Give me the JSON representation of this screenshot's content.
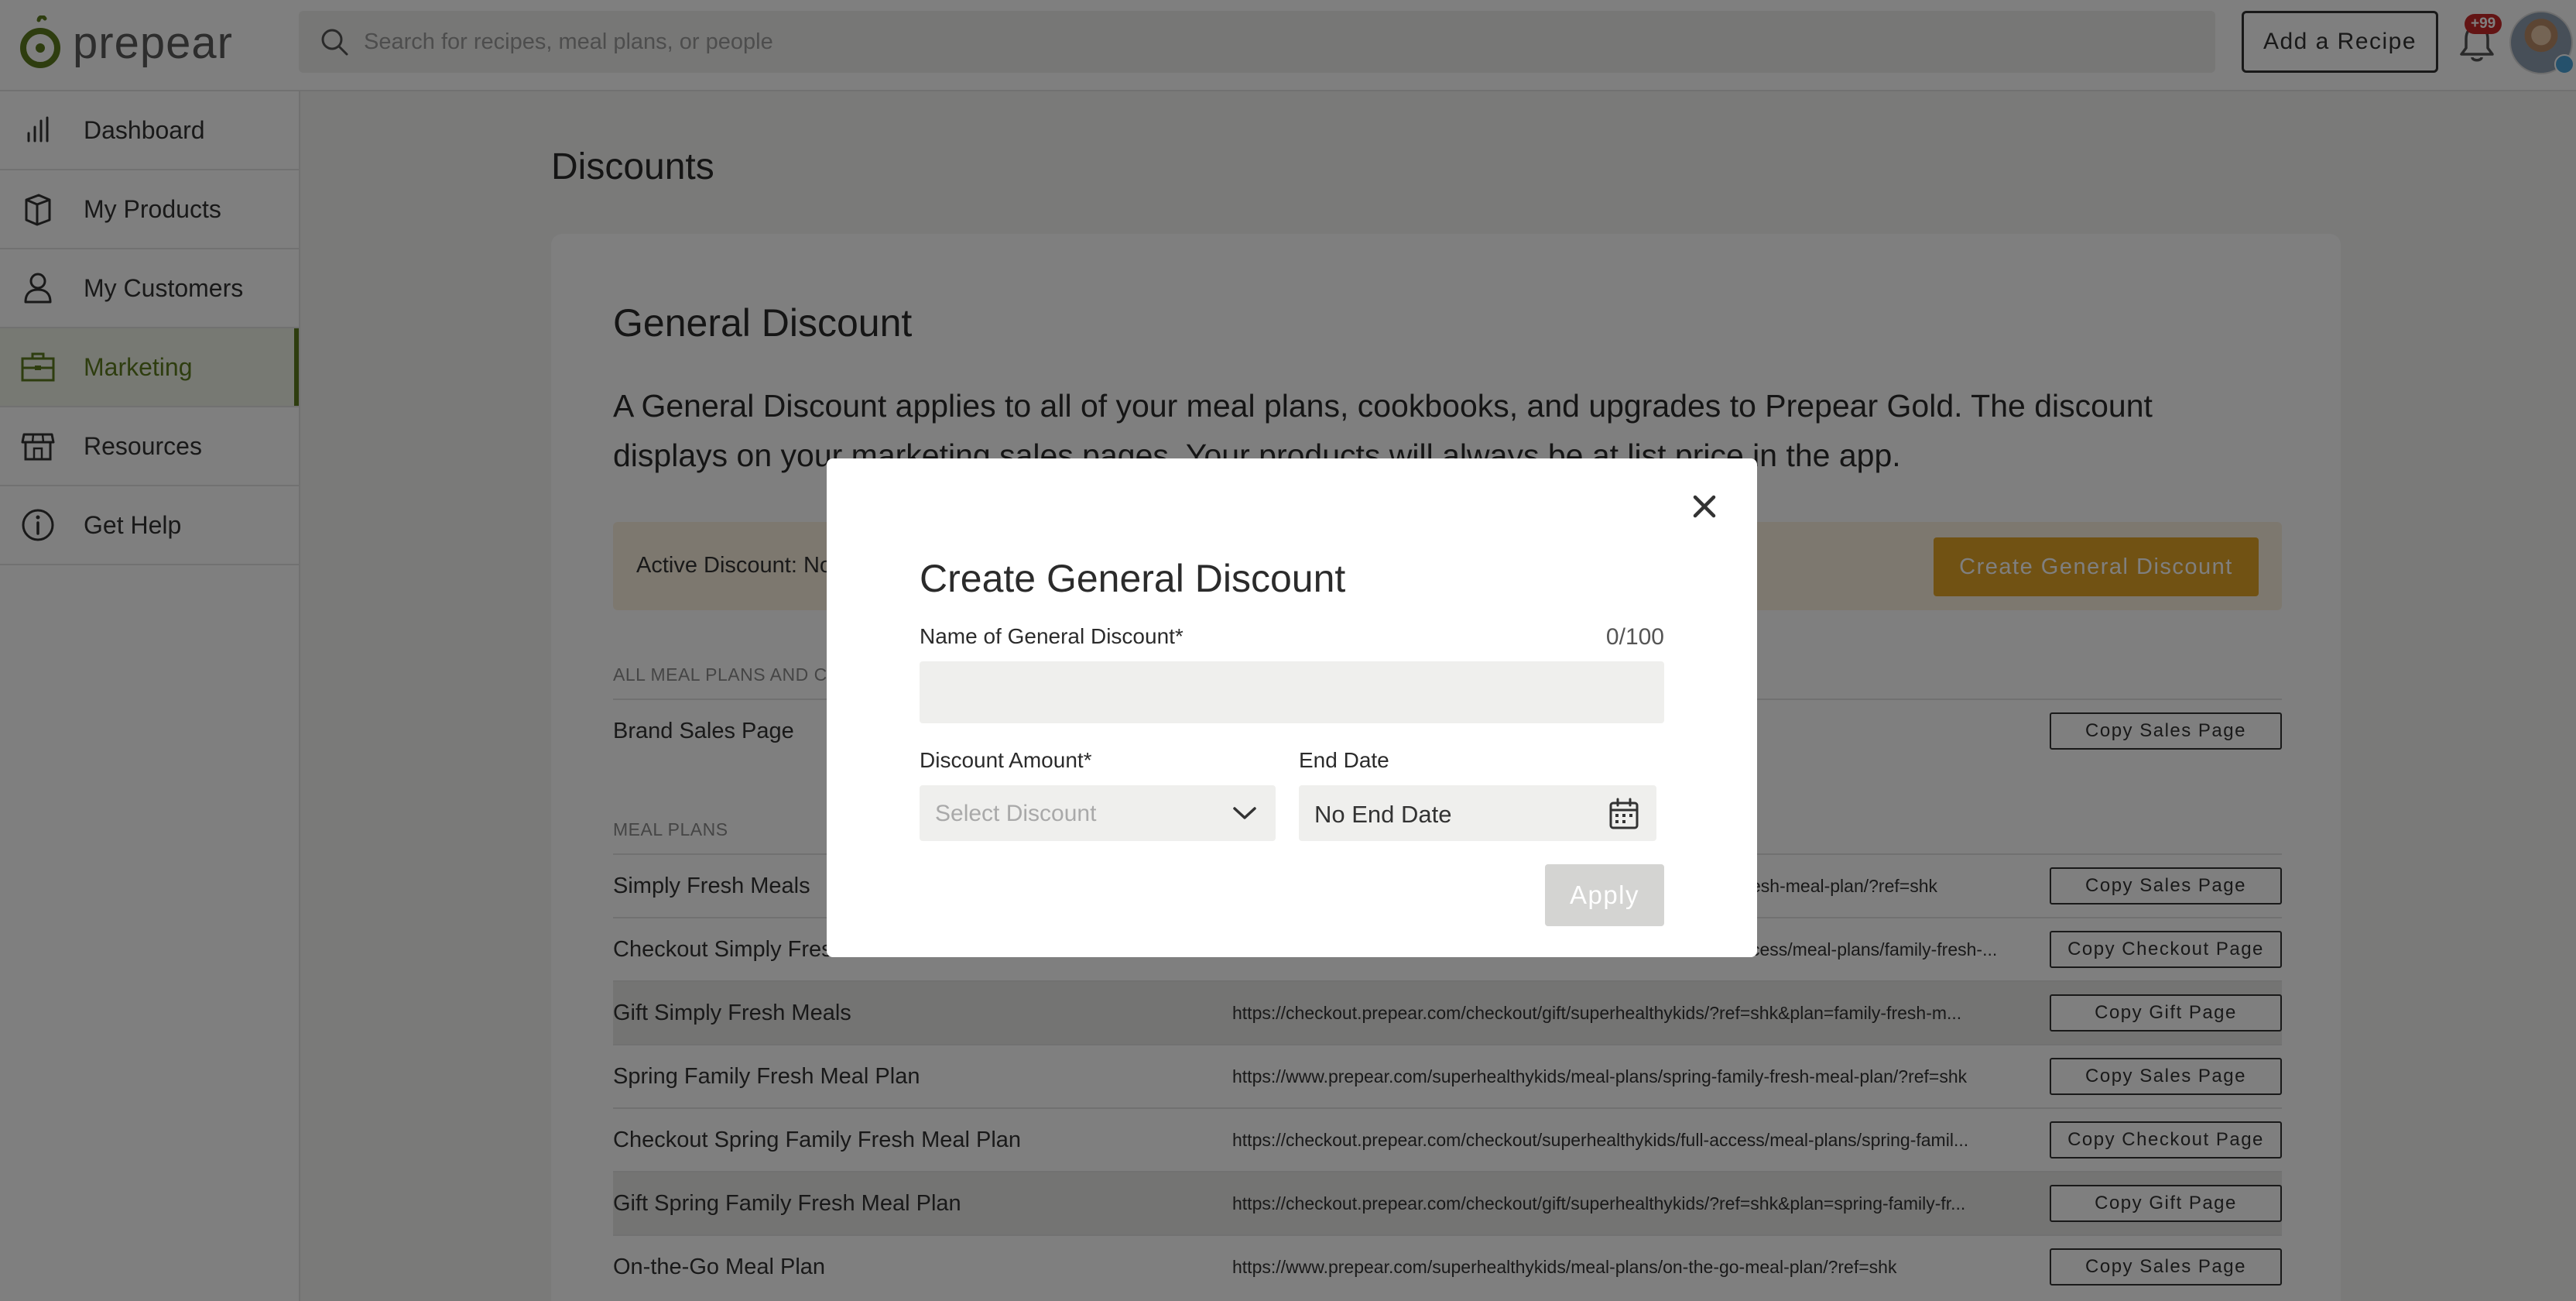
{
  "header": {
    "logo_text": "prepear",
    "search_placeholder": "Search for recipes, meal plans, or people",
    "add_recipe_label": "Add a Recipe",
    "notifications_badge": "+99"
  },
  "sidebar": {
    "items": [
      {
        "label": "Dashboard",
        "icon": "bar-chart-icon"
      },
      {
        "label": "My Products",
        "icon": "box-icon"
      },
      {
        "label": "My Customers",
        "icon": "person-icon"
      },
      {
        "label": "Marketing",
        "icon": "briefcase-icon",
        "active": true
      },
      {
        "label": "Resources",
        "icon": "storefront-icon"
      },
      {
        "label": "Get Help",
        "icon": "info-icon"
      }
    ]
  },
  "main": {
    "page_title": "Discounts",
    "card_title": "General Discount",
    "card_description": "A General Discount applies to all of your meal plans, cookbooks, and upgrades to Prepear Gold. The discount displays on your marketing sales pages. Your products will always be at list price in the app.",
    "active_discount_text": "Active Discount:  No",
    "create_button_label": "Create General Discount",
    "section_all": "ALL MEAL PLANS AND CO",
    "brand_row": {
      "name": "Brand Sales Page",
      "url": "",
      "button": "Copy Sales Page"
    },
    "section_meal_plans": "MEAL PLANS",
    "rows": [
      {
        "name": "Simply Fresh Meals",
        "url": "esh-meal-plan/?ref=shk",
        "button": "Copy Sales Page",
        "shaded": false
      },
      {
        "name": "Checkout Simply Fresh",
        "url": "cess/meal-plans/family-fresh-...",
        "button": "Copy Checkout Page",
        "shaded": false
      },
      {
        "name": "Gift Simply Fresh Meals",
        "url": "https://checkout.prepear.com/checkout/gift/superhealthykids/?ref=shk&plan=family-fresh-m...",
        "button": "Copy Gift Page",
        "shaded": true
      },
      {
        "name": "Spring Family Fresh Meal Plan",
        "url": "https://www.prepear.com/superhealthykids/meal-plans/spring-family-fresh-meal-plan/?ref=shk",
        "button": "Copy Sales Page",
        "shaded": false
      },
      {
        "name": "Checkout Spring Family Fresh Meal Plan",
        "url": "https://checkout.prepear.com/checkout/superhealthykids/full-access/meal-plans/spring-famil...",
        "button": "Copy Checkout Page",
        "shaded": false
      },
      {
        "name": "Gift Spring Family Fresh Meal Plan",
        "url": "https://checkout.prepear.com/checkout/gift/superhealthykids/?ref=shk&plan=spring-family-fr...",
        "button": "Copy Gift Page",
        "shaded": true
      },
      {
        "name": "On-the-Go Meal Plan",
        "url": "https://www.prepear.com/superhealthykids/meal-plans/on-the-go-meal-plan/?ref=shk",
        "button": "Copy Sales Page",
        "shaded": false
      }
    ]
  },
  "modal": {
    "title": "Create General Discount",
    "name_label": "Name of General Discount*",
    "name_counter": "0/100",
    "name_value": "",
    "amount_label": "Discount Amount*",
    "amount_placeholder": "Select Discount",
    "end_date_label": "End Date",
    "end_date_value": "No End Date",
    "apply_label": "Apply"
  },
  "colors": {
    "brand_green": "#5d7a1e",
    "create_button": "#e3a526",
    "active_bar_bg": "#fbf1df",
    "badge_red": "#c62828"
  }
}
